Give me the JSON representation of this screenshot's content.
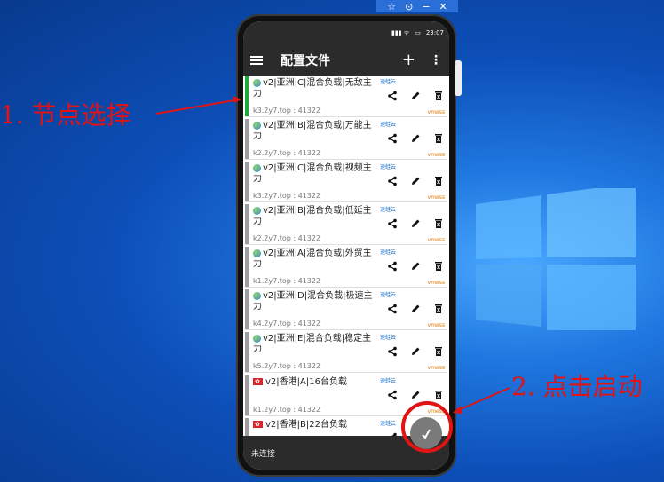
{
  "window_controls": [
    "☆",
    "⊙",
    "−",
    "✕"
  ],
  "status": {
    "time": "23:07"
  },
  "appbar": {
    "title": "配置文件",
    "add": "+",
    "more": "⋮"
  },
  "items": [
    {
      "name": "v2|亚洲|C|混合负载|无敌主力",
      "addr": "k3.2y7.top : 41322",
      "sub": "速蛙云",
      "proto": "vmess",
      "flag": "globe",
      "selected": true
    },
    {
      "name": "v2|亚洲|B|混合负载|万能主力",
      "addr": "k2.2y7.top : 41322",
      "sub": "速蛙云",
      "proto": "vmess",
      "flag": "globe"
    },
    {
      "name": "v2|亚洲|C|混合负载|视频主力",
      "addr": "k3.2y7.top : 41322",
      "sub": "速蛙云",
      "proto": "vmess",
      "flag": "globe"
    },
    {
      "name": "v2|亚洲|B|混合负载|低延主力",
      "addr": "k2.2y7.top : 41322",
      "sub": "速蛙云",
      "proto": "vmess",
      "flag": "globe"
    },
    {
      "name": "v2|亚洲|A|混合负载|外贸主力",
      "addr": "k1.2y7.top : 41322",
      "sub": "速蛙云",
      "proto": "vmess",
      "flag": "globe"
    },
    {
      "name": "v2|亚洲|D|混合负载|极速主力",
      "addr": "k4.2y7.top : 41322",
      "sub": "速蛙云",
      "proto": "vmess",
      "flag": "globe"
    },
    {
      "name": "v2|亚洲|E|混合负载|稳定主力",
      "addr": "k5.2y7.top : 41322",
      "sub": "速蛙云",
      "proto": "vmess",
      "flag": "globe"
    },
    {
      "name": "v2|香港|A|16台负载",
      "addr": "k1.2y7.top : 41322",
      "sub": "速蛙云",
      "proto": "vmess",
      "flag": "hk"
    },
    {
      "name": "v2|香港|B|22台负载",
      "addr": "",
      "sub": "速蛙云",
      "proto": "",
      "flag": "hk"
    }
  ],
  "bottom": {
    "status": "未连接"
  },
  "annotations": {
    "step1": "1. 节点选择",
    "step2": "2. 点击启动"
  },
  "colors": {
    "selected": "#1faa3c",
    "annotation": "#e01414",
    "sub": "#1e6fd0",
    "proto": "#e07a00"
  }
}
